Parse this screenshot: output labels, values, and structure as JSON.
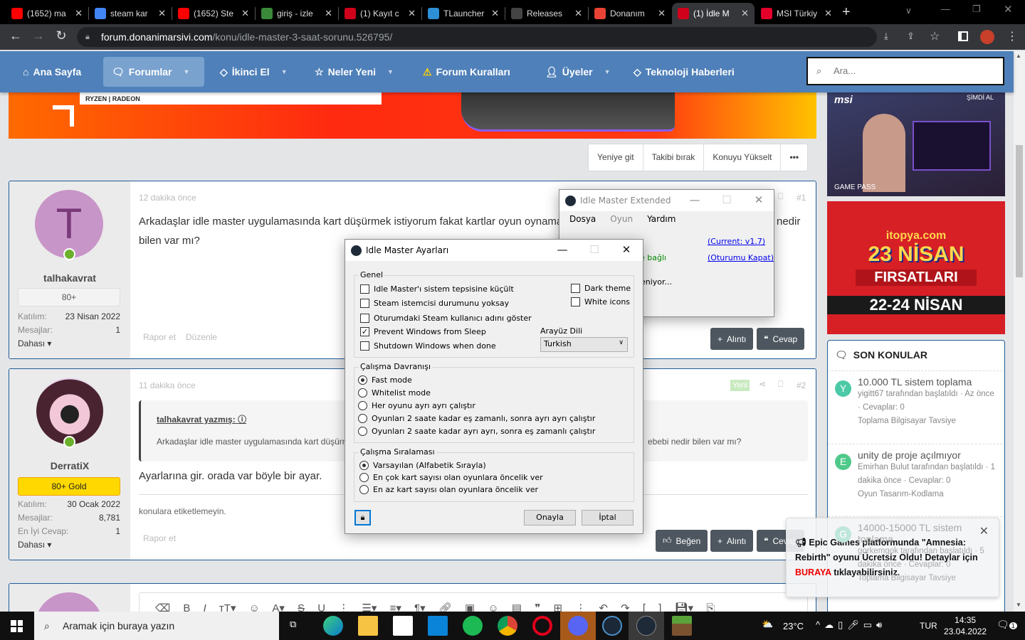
{
  "browser": {
    "tabs": [
      {
        "title": "(1652) ma",
        "icon": "youtube-icon",
        "color": "#ff0000"
      },
      {
        "title": "steam kar",
        "icon": "google-icon",
        "color": "#4285f4"
      },
      {
        "title": "(1652) Ste",
        "icon": "youtube-icon",
        "color": "#ff0000"
      },
      {
        "title": "giriş - izle",
        "icon": "globe-icon",
        "color": "#3a8a3a"
      },
      {
        "title": "(1) Kayıt c",
        "icon": "donanimarsivi-icon",
        "color": "#d0021b"
      },
      {
        "title": "TLauncher",
        "icon": "tlauncher-icon",
        "color": "#2d8fd5"
      },
      {
        "title": "Releases",
        "icon": "github-icon",
        "color": "#444444"
      },
      {
        "title": "Donanım",
        "icon": "gmail-icon",
        "color": "#ea4335"
      },
      {
        "title": "(1) İdle M",
        "icon": "donanimarsivi-icon",
        "color": "#d0021b"
      },
      {
        "title": "MSI Türkiy",
        "icon": "msi-icon",
        "color": "#e4002b"
      }
    ],
    "active_tab": 8,
    "url_host": "forum.donanimarsivi.com",
    "url_path": "/konu/idle-master-3-saat-sorunu.526795/"
  },
  "nav": {
    "items": [
      "Ana Sayfa",
      "Forumlar",
      "İkinci El",
      "Neler Yeni",
      "Forum Kuralları",
      "Üyeler",
      "Teknoloji Haberleri"
    ],
    "search_placeholder": "Ara..."
  },
  "ads": {
    "banner_text": "RYZEN | RADEON",
    "side1": {
      "brand": "msi",
      "cta": "ŞİMDİ AL",
      "tag": "GAME PASS"
    },
    "side2": {
      "brand": "itopya.com",
      "line1": "23 NİSAN",
      "line2": "FIRSATLARI",
      "line3": "22-24 NİSAN"
    }
  },
  "thread_actions": [
    "Yeniye git",
    "Takibi bırak",
    "Konuyu Yükselt",
    "•••"
  ],
  "posts": [
    {
      "avatar_letter": "T",
      "username": "talhakavrat",
      "badge": "80+",
      "joined_label": "Katılım:",
      "joined": "23 Nisan 2022",
      "messages_label": "Mesajlar:",
      "messages": "1",
      "more": "Dahası",
      "time": "12 dakika önce",
      "number": "#1",
      "body_line1": "Arkadaşlar idle master uygulamasında kart düşürmek istiyorum fakat kartlar oyun oynama",
      "body_tail": "nedir",
      "body_line2": "bilen var mı?",
      "report": "Rapor et",
      "edit": "Düzenle",
      "quote_btn": "Alıntı",
      "reply_btn": "Cevap"
    },
    {
      "username": "DerratiX",
      "badge": "80+ Gold",
      "joined_label": "Katılım:",
      "joined": "30 Ocak 2022",
      "messages_label": "Mesajlar:",
      "messages": "8,781",
      "best_label": "En İyi Cevap:",
      "best": "1",
      "more": "Dahası",
      "time": "11 dakika önce",
      "new_badge": "Yeni",
      "number": "#2",
      "quote_author": "talhakavrat yazmış:",
      "quote_text": "Arkadaşlar idle master uygulamasında kart düşürm",
      "quote_tail": "ebebi nedir bilen var mı?",
      "body": "Ayarlarına gir. orada var böyle bir ayar.",
      "signature": "konulara etiketlemeyin.",
      "report": "Rapor et",
      "like_btn": "Beğen",
      "quote_btn": "Alıntı",
      "reply_btn": "Cevap"
    }
  ],
  "sidebar": {
    "title": "SON KONULAR",
    "topics": [
      {
        "letter": "Y",
        "color": "#4cc9a6",
        "title": "10.000 TL sistem toplama",
        "meta": "yigitt67 tarafından başlatıldı · Az önce · Cevaplar: 0",
        "forum": "Toplama Bilgisayar Tavsiye"
      },
      {
        "letter": "E",
        "color": "#4fc98a",
        "title": "unity de proje açılmıyor",
        "meta": "Emirhan Bulut tarafından başlatıldı · 1 dakika önce · Cevaplar: 0",
        "forum": "Oyun Tasarım-Kodlama"
      },
      {
        "letter": "G",
        "color": "#6cc7b0",
        "title": "14000-15000 TL sistem toplama",
        "meta": "gorkemgok tarafından başlatıldı · 5 dakika önce · Cevaplar: 0",
        "forum": "Toplama Bilgisayar Tavsiye"
      }
    ]
  },
  "toast": {
    "text": "Epic Games platformunda \"Amnesia: Rebirth\" oyunu Ücretsiz Oldu! Detaylar için",
    "link": "BURAYA",
    "text2": "tıklayabilirsiniz."
  },
  "idle_main": {
    "title": "Idle Master Extended",
    "menu": [
      "Dosya",
      "Oyun",
      "Yardım"
    ],
    "version_link": "(Current: v1.7)",
    "logout_link": "(Oturumu Kapat)",
    "status_connected": "'e bağlı",
    "status_loading": "eniyor..."
  },
  "settings": {
    "title": "Idle Master Ayarları",
    "general_label": "Genel",
    "general": [
      {
        "label": "Idle Master'ı sistem tepsisine küçült",
        "checked": false
      },
      {
        "label": "Steam istemcisi durumunu yoksay",
        "checked": false
      },
      {
        "label": "Oturumdaki Steam kullanıcı adını göster",
        "checked": false
      },
      {
        "label": "Prevent Windows from Sleep",
        "checked": true
      },
      {
        "label": "Shutdown Windows when done",
        "checked": false
      }
    ],
    "dark_theme": {
      "label": "Dark theme",
      "checked": false
    },
    "white_icons": {
      "label": "White icons",
      "checked": false
    },
    "language_label": "Arayüz Dili",
    "language": "Turkish",
    "behavior_label": "Çalışma Davranışı",
    "behavior": [
      "Fast mode",
      "Whitelist mode",
      "Her oyunu ayrı ayrı çalıştır",
      "Oyunları 2 saate kadar eş zamanlı, sonra ayrı ayrı çalıştır",
      "Oyunları 2 saate kadar ayrı ayrı, sonra eş zamanlı çalıştır"
    ],
    "behavior_selected": 0,
    "order_label": "Çalışma Sıralaması",
    "order": [
      "Varsayılan (Alfabetik Sırayla)",
      "En çok kart sayısı olan oyunlara öncelik ver",
      "En az kart sayısı olan oyunlara öncelik ver"
    ],
    "order_selected": 0,
    "ok": "Onayla",
    "cancel": "İptal"
  },
  "taskbar": {
    "search_placeholder": "Aramak için buraya yazın",
    "weather": "23°C",
    "lang": "TUR",
    "time": "14:35",
    "date": "23.04.2022",
    "notifications": "1"
  }
}
